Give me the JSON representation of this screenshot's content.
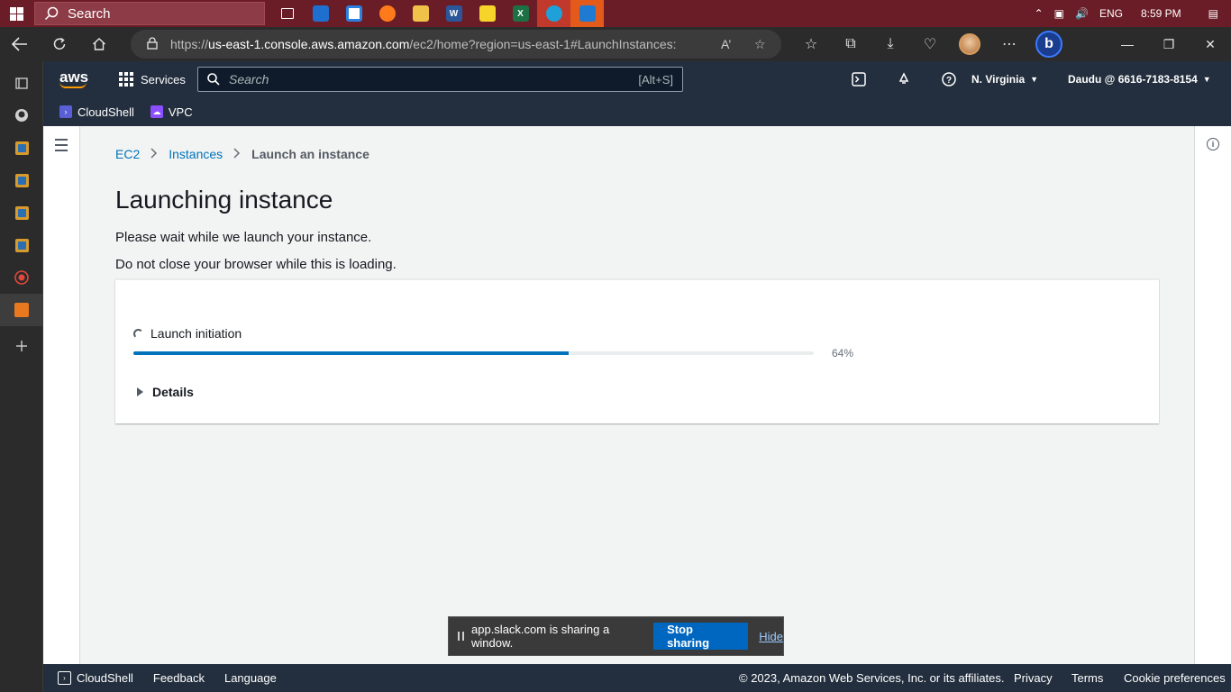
{
  "taskbar": {
    "search_placeholder": "Search",
    "language": "ENG",
    "time": "8:59 PM"
  },
  "browser": {
    "url_prefix": "https://",
    "url_host": "us-east-1.console.aws.amazon.com",
    "url_path": "/ec2/home?region=us-east-1#LaunchInstances:"
  },
  "aws_header": {
    "logo": "aws",
    "services_label": "Services",
    "search_placeholder": "Search",
    "search_shortcut": "[Alt+S]",
    "region": "N. Virginia",
    "account": "Daudu @ 6616-7183-8154"
  },
  "favorites": [
    {
      "label": "CloudShell",
      "color": "#5a5fd6"
    },
    {
      "label": "VPC",
      "color": "#8c4fff"
    }
  ],
  "breadcrumb": {
    "items": [
      "EC2",
      "Instances"
    ],
    "current": "Launch an instance"
  },
  "main": {
    "title": "Launching instance",
    "message_1": "Please wait while we launch your instance.",
    "message_2": "Do not close your browser while this is loading.",
    "status_label": "Launch initiation",
    "progress_percent": 64,
    "progress_label": "64%",
    "details_label": "Details"
  },
  "share_bar": {
    "message": "app.slack.com is sharing a window.",
    "stop_label": "Stop sharing",
    "hide_label": "Hide"
  },
  "footer": {
    "cloudshell": "CloudShell",
    "feedback": "Feedback",
    "language": "Language",
    "copyright": "© 2023, Amazon Web Services, Inc. or its affiliates.",
    "privacy": "Privacy",
    "terms": "Terms",
    "cookies": "Cookie preferences"
  },
  "colors": {
    "aws_dark": "#232f3e",
    "aws_orange": "#ff9900",
    "link_blue": "#0073bb",
    "taskbar": "#6b1d27"
  }
}
